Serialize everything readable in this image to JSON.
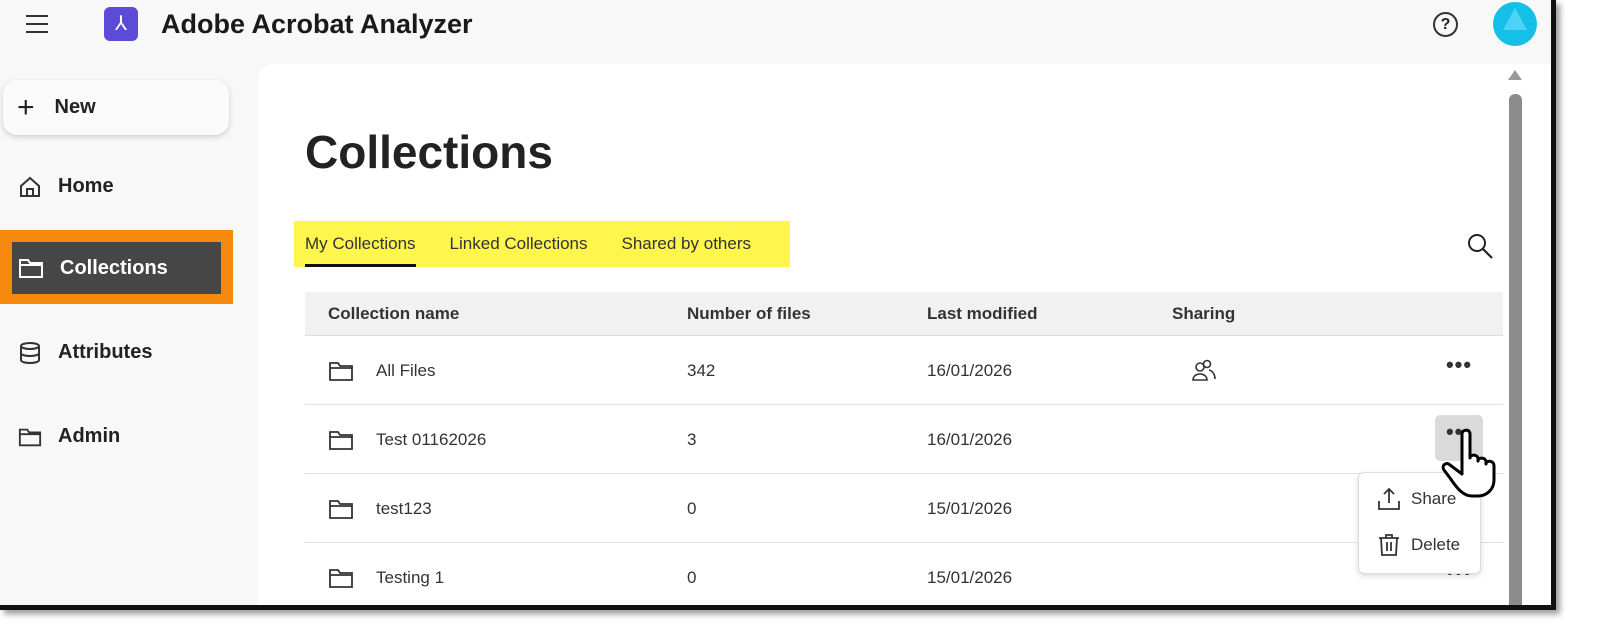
{
  "app": {
    "title": "Adobe Acrobat Analyzer"
  },
  "sidebar": {
    "new_label": "New",
    "items": [
      {
        "label": "Home"
      },
      {
        "label": "Collections"
      },
      {
        "label": "Attributes"
      },
      {
        "label": "Admin"
      }
    ]
  },
  "page": {
    "title": "Collections"
  },
  "tabs": [
    {
      "label": "My Collections"
    },
    {
      "label": "Linked Collections"
    },
    {
      "label": "Shared by others"
    }
  ],
  "table": {
    "headers": [
      "Collection name",
      "Number of files",
      "Last modified",
      "Sharing"
    ],
    "rows": [
      {
        "name": "All Files",
        "files": "342",
        "modified": "16/01/2026",
        "shared": true
      },
      {
        "name": "Test 01162026",
        "files": "3",
        "modified": "16/01/2026",
        "shared": false
      },
      {
        "name": "test123",
        "files": "0",
        "modified": "15/01/2026",
        "shared": false
      },
      {
        "name": "Testing 1",
        "files": "0",
        "modified": "15/01/2026",
        "shared": false
      }
    ]
  },
  "context_menu": {
    "share": "Share",
    "delete": "Delete"
  },
  "colors": {
    "highlight_nav": "#f7890f",
    "highlight_tabs": "#fef54d",
    "logo": "#5c4bd6"
  }
}
